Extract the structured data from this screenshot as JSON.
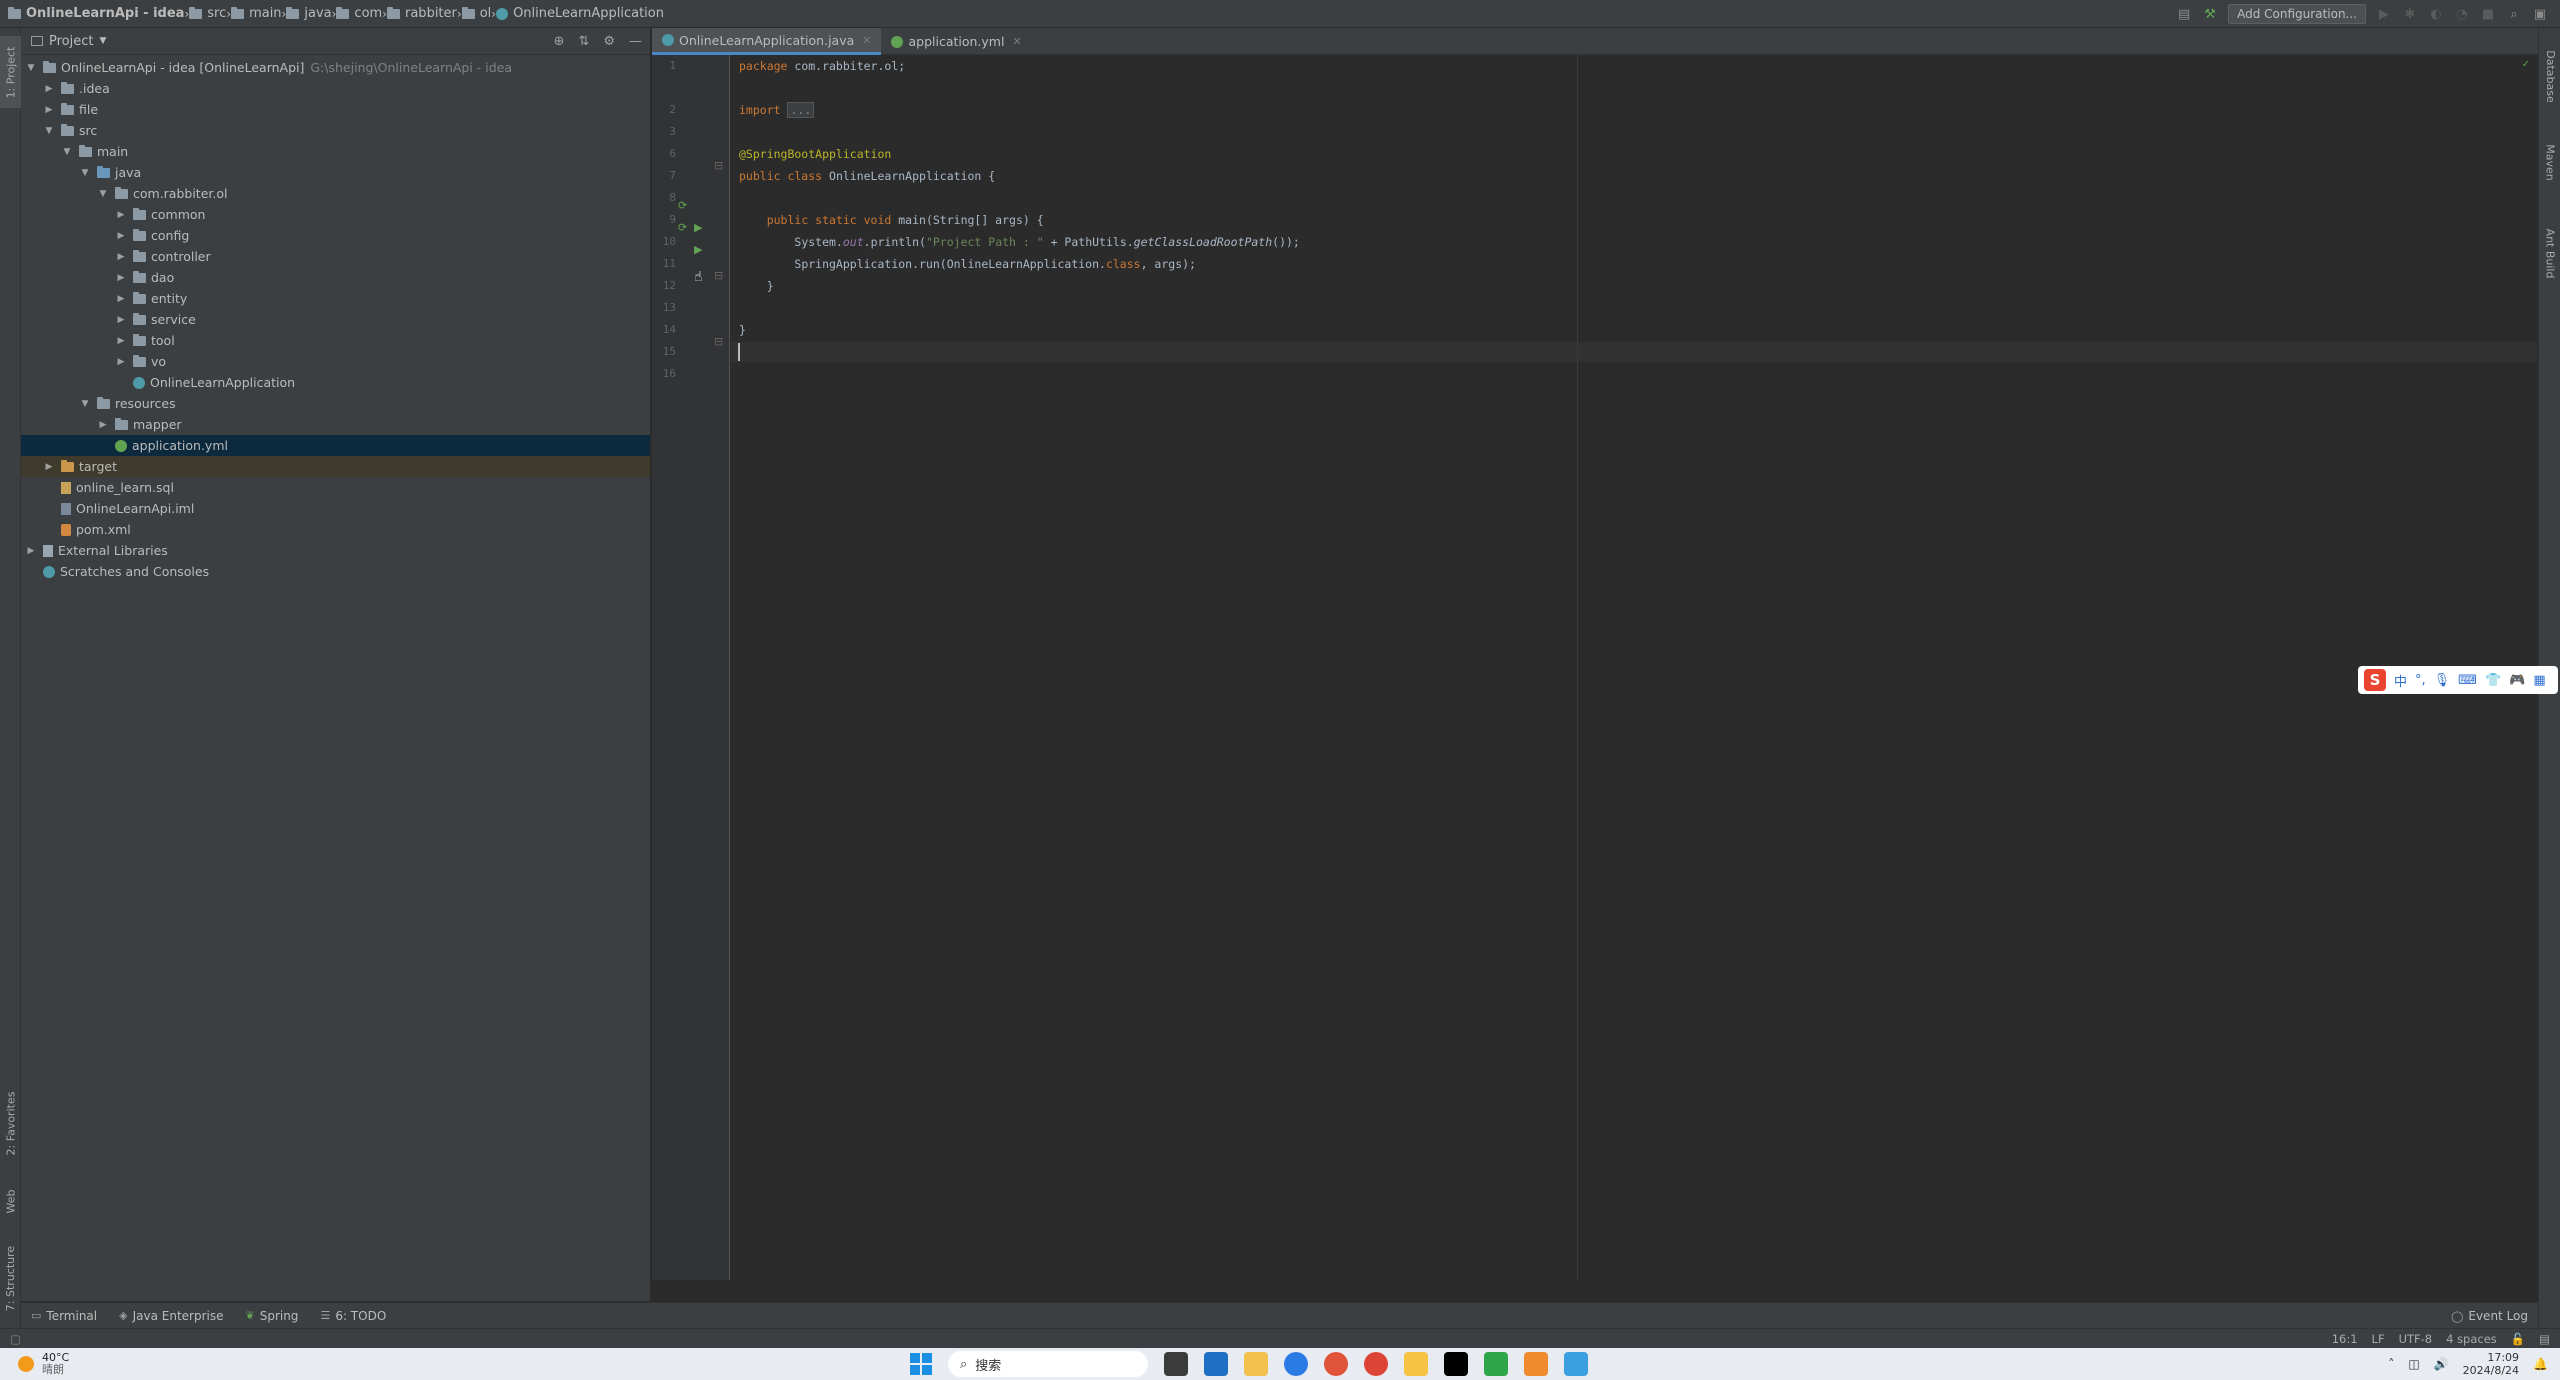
{
  "navbar": {
    "breadcrumbs": [
      {
        "label": "OnlineLearnApi - idea",
        "icon": "folder-icon"
      },
      {
        "label": "src",
        "icon": "folder-icon"
      },
      {
        "label": "main",
        "icon": "folder-icon"
      },
      {
        "label": "java",
        "icon": "folder-icon"
      },
      {
        "label": "com",
        "icon": "folder-icon"
      },
      {
        "label": "rabbiter",
        "icon": "folder-icon"
      },
      {
        "label": "ol",
        "icon": "folder-icon"
      },
      {
        "label": "OnlineLearnApplication",
        "icon": "spring-class-icon"
      }
    ],
    "add_configuration": "Add Configuration..."
  },
  "left_strip": {
    "project_tab": "1: Project",
    "favorites_tab": "2: Favorites",
    "web_tab": "Web",
    "structure_tab": "7: Structure"
  },
  "right_strip": {
    "database_tab": "Database",
    "maven_tab": "Maven",
    "ant_tab": "Ant Build"
  },
  "project": {
    "header": "Project",
    "tree": [
      {
        "label": "OnlineLearnApi - idea [OnlineLearnApi]",
        "path": "G:\\shejing\\OnlineLearnApi - idea",
        "indent": 0,
        "expanded": true,
        "icon": "module"
      },
      {
        "label": ".idea",
        "indent": 1,
        "expanded": false,
        "icon": "folder"
      },
      {
        "label": "file",
        "indent": 1,
        "expanded": false,
        "icon": "folder"
      },
      {
        "label": "src",
        "indent": 1,
        "expanded": true,
        "icon": "folder"
      },
      {
        "label": "main",
        "indent": 2,
        "expanded": true,
        "icon": "folder"
      },
      {
        "label": "java",
        "indent": 3,
        "expanded": true,
        "icon": "folder-blue"
      },
      {
        "label": "com.rabbiter.ol",
        "indent": 4,
        "expanded": true,
        "icon": "folder"
      },
      {
        "label": "common",
        "indent": 5,
        "expanded": false,
        "icon": "folder"
      },
      {
        "label": "config",
        "indent": 5,
        "expanded": false,
        "icon": "folder"
      },
      {
        "label": "controller",
        "indent": 5,
        "expanded": false,
        "icon": "folder"
      },
      {
        "label": "dao",
        "indent": 5,
        "expanded": false,
        "icon": "folder"
      },
      {
        "label": "entity",
        "indent": 5,
        "expanded": false,
        "icon": "folder"
      },
      {
        "label": "service",
        "indent": 5,
        "expanded": false,
        "icon": "folder"
      },
      {
        "label": "tool",
        "indent": 5,
        "expanded": false,
        "icon": "folder"
      },
      {
        "label": "vo",
        "indent": 5,
        "expanded": false,
        "icon": "folder"
      },
      {
        "label": "OnlineLearnApplication",
        "indent": 5,
        "expanded": null,
        "icon": "spring-class"
      },
      {
        "label": "resources",
        "indent": 3,
        "expanded": true,
        "icon": "folder"
      },
      {
        "label": "mapper",
        "indent": 4,
        "expanded": false,
        "icon": "folder"
      },
      {
        "label": "application.yml",
        "indent": 4,
        "expanded": null,
        "icon": "yml",
        "selected": true
      },
      {
        "label": "target",
        "indent": 1,
        "expanded": false,
        "icon": "folder-orange",
        "highlight": true
      },
      {
        "label": "online_learn.sql",
        "indent": 1,
        "expanded": null,
        "icon": "sql"
      },
      {
        "label": "OnlineLearnApi.iml",
        "indent": 1,
        "expanded": null,
        "icon": "iml"
      },
      {
        "label": "pom.xml",
        "indent": 1,
        "expanded": null,
        "icon": "xml"
      },
      {
        "label": "External Libraries",
        "indent": 0,
        "expanded": false,
        "icon": "library"
      },
      {
        "label": "Scratches and Consoles",
        "indent": 0,
        "expanded": null,
        "icon": "scratch"
      }
    ]
  },
  "editor": {
    "tabs": [
      {
        "label": "OnlineLearnApplication.java",
        "active": true
      },
      {
        "label": "application.yml",
        "active": false
      }
    ],
    "line_numbers": [
      "1",
      "2",
      "3",
      "6",
      "7",
      "8",
      "9",
      "10",
      "11",
      "12",
      "13",
      "14",
      "15",
      "16"
    ],
    "lines": {
      "l1_kw": "package",
      "l1_rest": " com.rabbiter.ol;",
      "l3_kw": "import",
      "l3_fold": "...",
      "l7_ann": "@SpringBootApplication",
      "l8_kw": "public class",
      "l8_rest": " OnlineLearnApplication {",
      "l10_kw": "public static void",
      "l10_rest": " main(String[] args) {",
      "l11_a": "System.",
      "l11_field": "out",
      "l11_b": ".println(",
      "l11_str": "\"Project Path : \"",
      "l11_c": " + PathUtils.",
      "l11_method": "getClassLoadRootPath",
      "l11_d": "());",
      "l12_a": "SpringApplication.run(OnlineLearnApplication.",
      "l12_kw": "class",
      "l12_b": ", args);",
      "l13": "}",
      "l15": "}"
    }
  },
  "bottom_tools": {
    "terminal": "Terminal",
    "java_enterprise": "Java Enterprise",
    "spring": "Spring",
    "todo": "6: TODO",
    "event_log": "Event Log"
  },
  "status_bar": {
    "position": "16:1",
    "line_sep": "LF",
    "encoding": "UTF-8",
    "indent": "4 spaces"
  },
  "ime": {
    "logo": "S",
    "mode": "中",
    "punct": "°,"
  },
  "taskbar": {
    "temperature": "40°C",
    "weather": "晴朗",
    "search_placeholder": "搜索",
    "time": "17:09",
    "date": "2024/8/24"
  },
  "colors": {
    "background": "#2b2b2b",
    "panel": "#3c3f41",
    "selection": "#0d293e",
    "keyword": "#cc7832",
    "annotation": "#bbb529",
    "string": "#6a8759"
  }
}
